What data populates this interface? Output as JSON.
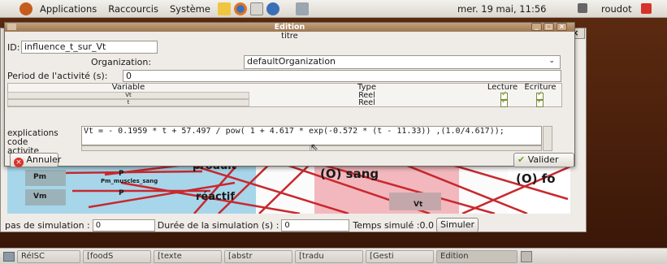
{
  "panel": {
    "menus": [
      "Applications",
      "Raccourcis",
      "Système"
    ],
    "clock": "mer. 19 mai, 11:56",
    "user": "roudot"
  },
  "dialog": {
    "title": "Edition",
    "subtitle": "titre",
    "id_label": "ID:",
    "id_value": "influence_t_sur_Vt",
    "org_label": "Organization:",
    "org_value": "defaultOrganization",
    "period_label": "Period de l'activité (s):",
    "period_value": "0",
    "table": {
      "headers": [
        "Variable",
        "Type",
        "Lecture",
        "Ecriture"
      ],
      "rows": [
        {
          "variable": "Vt",
          "type": "Reel"
        },
        {
          "variable": "t",
          "type": "Reel"
        }
      ]
    },
    "expl_label_1": "explications",
    "expl_label_2": "code",
    "expl_label_3": "activite",
    "code": "Vt = - 0.1959 * t + 57.497 / pow( 1 + 4.617 * exp(-0.572 * (t - 11.33)) ,(1.0/4.617));",
    "cancel": "Annuler",
    "validate": "Valider"
  },
  "diagram": {
    "nodes": [
      "Pm",
      "Vm",
      "P",
      "P",
      "Pm_muscles_sang",
      "produit",
      "réactif",
      "(O) sang",
      "Vt",
      "(O) fo"
    ]
  },
  "simbar": {
    "step_label": "pas de simulation :",
    "step_value": "0",
    "duration_label": "Durée de la simulation (s) :",
    "duration_value": "0",
    "time_label": "Temps simulé :0.0",
    "simulate": "Simuler"
  },
  "taskbar": [
    "RéISC",
    "[foodS",
    "[texte",
    "[abstr",
    "[tradu",
    "[Gesti",
    "Edition"
  ],
  "colors": {
    "title": "#a8835e",
    "diagram_line": "#c8282e",
    "blue": "#a7d6ea",
    "pink": "#f2b8bd"
  }
}
